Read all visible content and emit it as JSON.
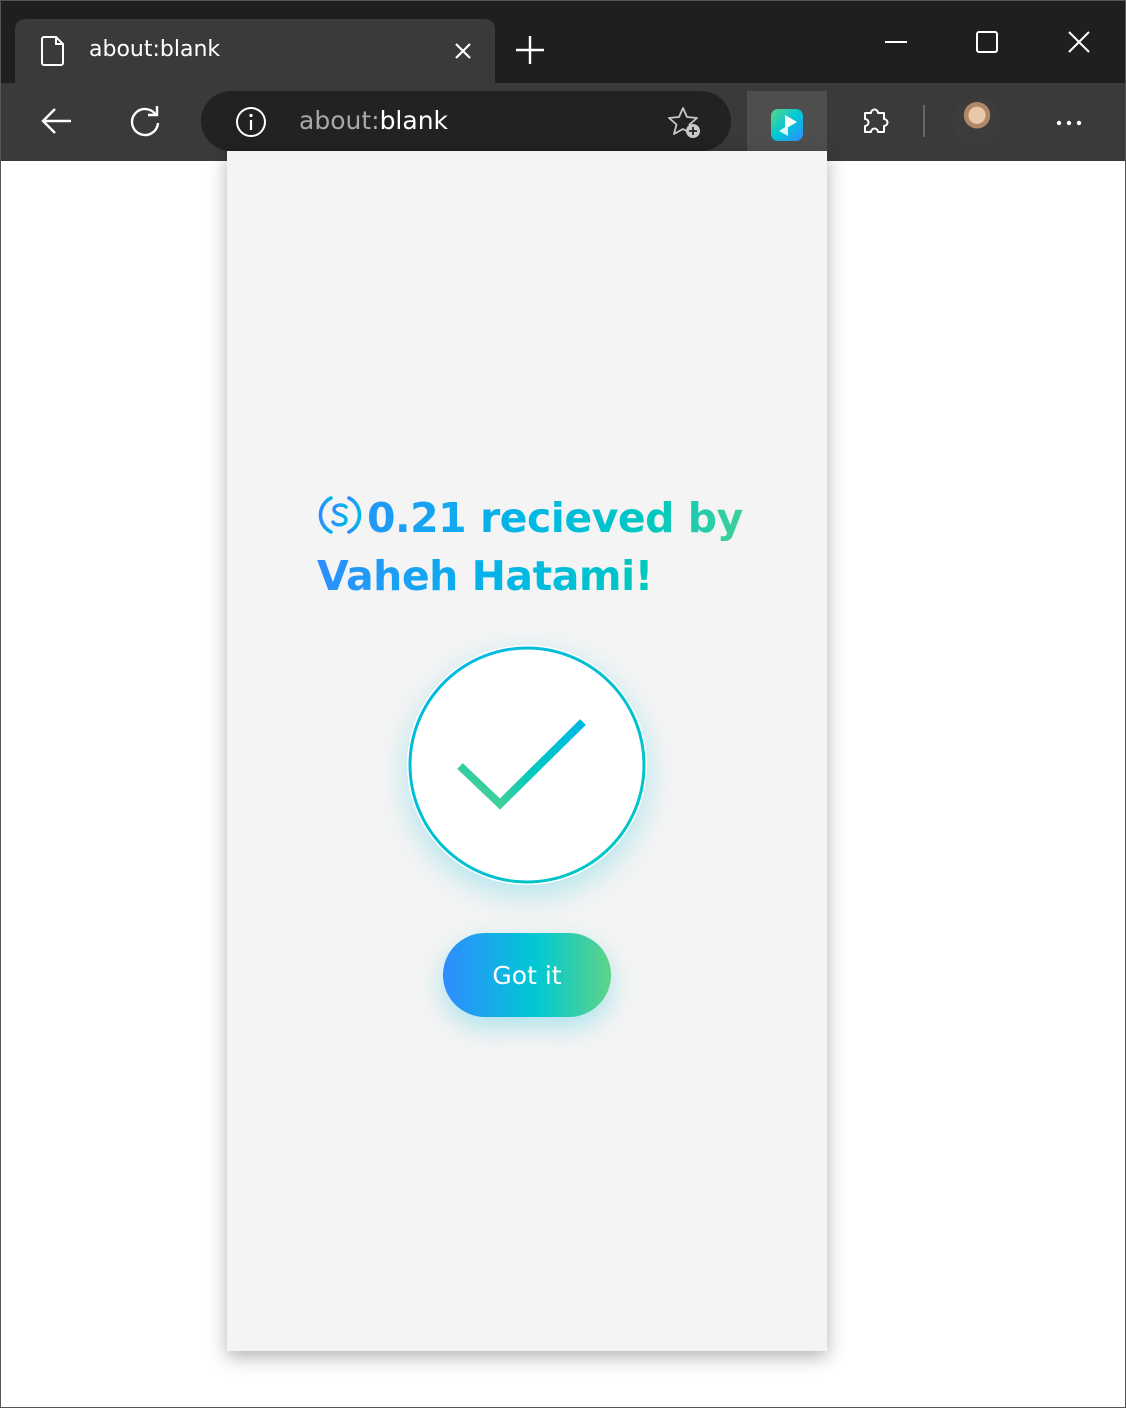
{
  "browser": {
    "tab_title": "about:blank",
    "url_scheme": "about:",
    "url_rest": "blank"
  },
  "popup": {
    "amount": "0.21",
    "message_middle": " recieved by ",
    "recipient": "Vaheh Hatami!",
    "currency_icon": "usdc-dollar-circle-icon",
    "button_label": "Got it",
    "status_icon": "checkmark-icon"
  },
  "colors": {
    "gradient_blue": "#2f8cff",
    "gradient_cyan": "#00c8d4",
    "gradient_green": "#5ed388",
    "panel_bg": "#f4f4f4",
    "chrome_dark": "#1f1f1f",
    "chrome_toolbar": "#3a3a3a"
  }
}
